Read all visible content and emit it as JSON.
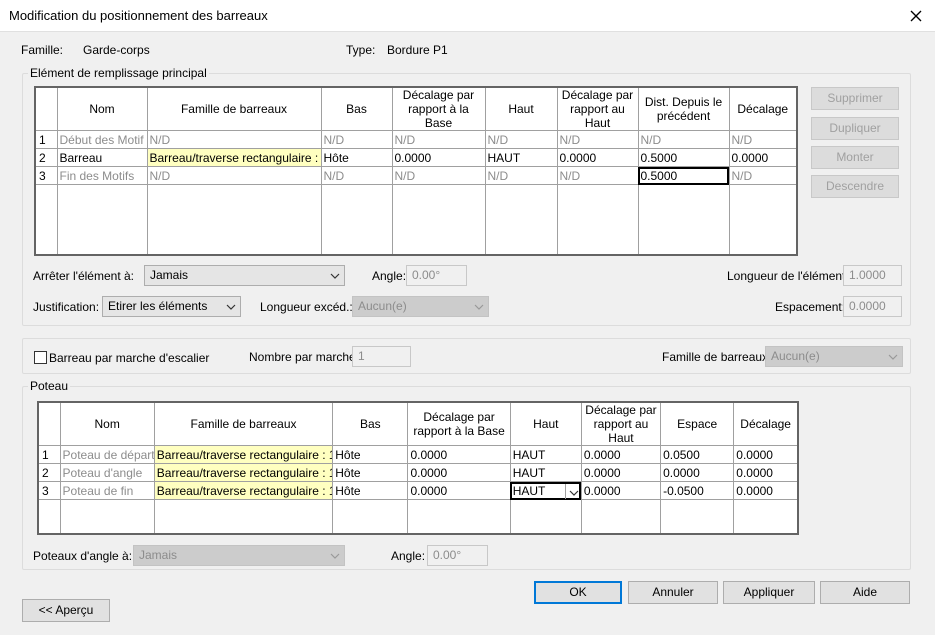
{
  "window": {
    "title": "Modification du positionnement des barreaux",
    "close_icon": "close-icon"
  },
  "header": {
    "famille_label": "Famille:",
    "famille_value": "Garde-corps",
    "type_label": "Type:",
    "type_value": "Bordure P1"
  },
  "main_section": {
    "legend": "Elément de remplissage principal",
    "columns": [
      "Nom",
      "Famille de barreaux",
      "Bas",
      "Décalage par rapport à la Base",
      "Haut",
      "Décalage par rapport au Haut",
      "Dist. Depuis le précédent",
      "Décalage"
    ],
    "rows": [
      {
        "index": "1",
        "cells": [
          "Début des Motif",
          "N/D",
          "N/D",
          "N/D",
          "N/D",
          "N/D",
          "N/D",
          "N/D"
        ]
      },
      {
        "index": "2",
        "cells": [
          "Barreau",
          "Barreau/traverse rectangulaire :",
          "Hôte",
          "0.0000",
          "HAUT",
          "0.0000",
          "0.5000",
          "0.0000"
        ]
      },
      {
        "index": "3",
        "cells": [
          "Fin des Motifs",
          "N/D",
          "N/D",
          "N/D",
          "N/D",
          "N/D",
          "0.5000",
          "N/D"
        ]
      }
    ],
    "buttons": {
      "supprimer": "Supprimer",
      "dupliquer": "Dupliquer",
      "monter": "Monter",
      "descendre": "Descendre"
    },
    "arreter_label": "Arrêter l'élément à:",
    "arreter_value": "Jamais",
    "angle_label": "Angle:",
    "angle_value": "0.00°",
    "longueur_element_label": "Longueur de l'élément:",
    "longueur_element_value": "1.0000",
    "justification_label": "Justification:",
    "justification_value": "Etirer les éléments",
    "longueur_exced_label": "Longueur excéd.:",
    "longueur_exced_value": "Aucun(e)",
    "espacement_label": "Espacement:",
    "espacement_value": "0.0000"
  },
  "stair_section": {
    "checkbox_label": "Barreau par marche d'escalier",
    "nombre_label": "Nombre par marche:",
    "nombre_value": "1",
    "famille_label": "Famille de barreaux:",
    "famille_value": "Aucun(e)"
  },
  "poteau_section": {
    "legend": "Poteau",
    "columns": [
      "Nom",
      "Famille de barreaux",
      "Bas",
      "Décalage par rapport à la Base",
      "Haut",
      "Décalage par rapport au Haut",
      "Espace",
      "Décalage"
    ],
    "rows": [
      {
        "index": "1",
        "cells": [
          "Poteau de départ",
          "Barreau/traverse rectangulaire : 1",
          "Hôte",
          "0.0000",
          "HAUT",
          "0.0000",
          "0.0500",
          "0.0000"
        ]
      },
      {
        "index": "2",
        "cells": [
          "Poteau d'angle",
          "Barreau/traverse rectangulaire : 1",
          "Hôte",
          "0.0000",
          "HAUT",
          "0.0000",
          "0.0000",
          "0.0000"
        ]
      },
      {
        "index": "3",
        "cells": [
          "Poteau de fin",
          "Barreau/traverse rectangulaire : 1",
          "Hôte",
          "0.0000",
          "HAUT",
          "0.0000",
          "-0.0500",
          "0.0000"
        ]
      }
    ],
    "angle_posts_label": "Poteaux d'angle à:",
    "angle_posts_value": "Jamais",
    "angle_label": "Angle:",
    "angle_value": "0.00°"
  },
  "footer": {
    "apercu": "<< Aperçu",
    "ok": "OK",
    "annuler": "Annuler",
    "appliquer": "Appliquer",
    "aide": "Aide"
  }
}
